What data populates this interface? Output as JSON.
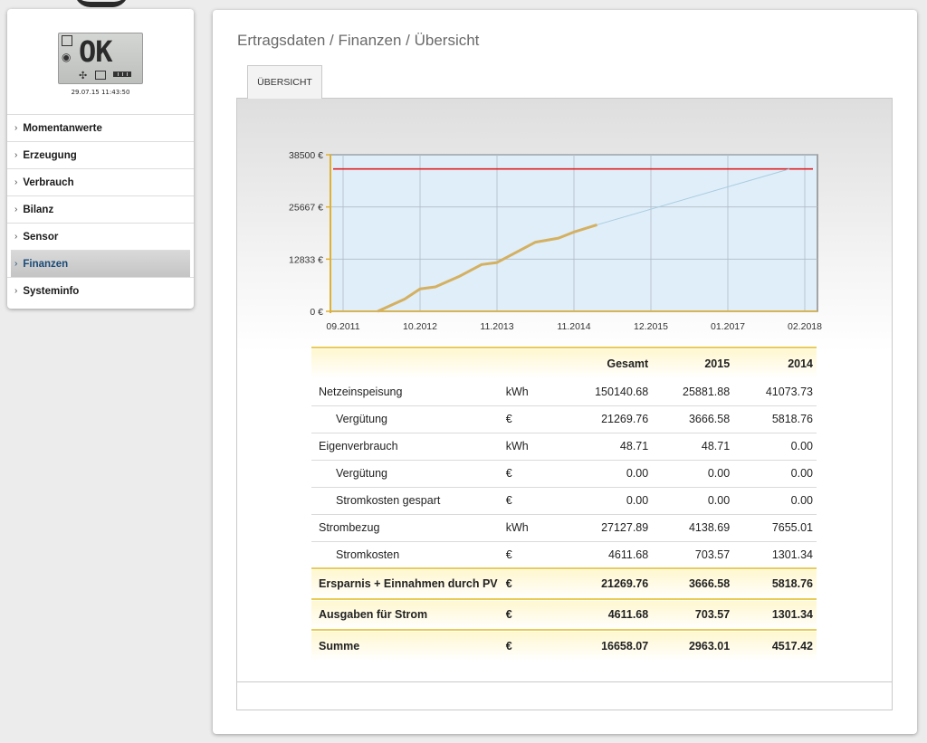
{
  "sidebar": {
    "lcd_text": "OK",
    "datetime": "29.07.15 11:43:50",
    "items": [
      {
        "label": "Momentanwerte",
        "active": false
      },
      {
        "label": "Erzeugung",
        "active": false
      },
      {
        "label": "Verbrauch",
        "active": false
      },
      {
        "label": "Bilanz",
        "active": false
      },
      {
        "label": "Sensor",
        "active": false
      },
      {
        "label": "Finanzen",
        "active": true
      },
      {
        "label": "Systeminfo",
        "active": false
      }
    ]
  },
  "main": {
    "breadcrumb": "Ertragsdaten / Finanzen / Übersicht",
    "tab_label": "ÜBERSICHT"
  },
  "chart_data": {
    "type": "line",
    "y_ticks": [
      "38500 €",
      "25667 €",
      "12833 €",
      "0 €"
    ],
    "y_tick_values": [
      38500,
      25667,
      12833,
      0
    ],
    "x_ticks": [
      "09.2011",
      "10.2012",
      "11.2013",
      "11.2014",
      "12.2015",
      "01.2017",
      "02.2018"
    ],
    "ylim": [
      0,
      38500
    ],
    "grid": true,
    "target_line": 35000,
    "series": [
      {
        "values_x": [
          0.45,
          0.8,
          1.0,
          1.2,
          1.5,
          1.8,
          2.0,
          2.2,
          2.5,
          2.8,
          3.0,
          3.3
        ],
        "values_y": [
          0,
          3000,
          5500,
          6000,
          8500,
          11500,
          12000,
          14000,
          17000,
          18000,
          19500,
          21269
        ],
        "color": "#d4b060"
      },
      {
        "values_x": [
          3.3,
          5.8
        ],
        "values_y": [
          21269,
          35000
        ],
        "color": "#a8cce0"
      }
    ],
    "colors": {
      "plot_bg": "#e0eef9",
      "axis": "#e0b030",
      "target": "#e02020",
      "grid": "#b0bcc8"
    }
  },
  "table": {
    "headers": [
      "",
      "",
      "Gesamt",
      "2015",
      "2014"
    ],
    "rows": [
      {
        "label": "Netzeinspeisung",
        "sub": false,
        "unit": "kWh",
        "values": [
          "150140.68",
          "25881.88",
          "41073.73"
        ]
      },
      {
        "label": "Vergütung",
        "sub": true,
        "unit": "€",
        "values": [
          "21269.76",
          "3666.58",
          "5818.76"
        ]
      },
      {
        "label": "Eigenverbrauch",
        "sub": false,
        "unit": "kWh",
        "values": [
          "48.71",
          "48.71",
          "0.00"
        ]
      },
      {
        "label": "Vergütung",
        "sub": true,
        "unit": "€",
        "values": [
          "0.00",
          "0.00",
          "0.00"
        ]
      },
      {
        "label": "Stromkosten gespart",
        "sub": true,
        "unit": "€",
        "values": [
          "0.00",
          "0.00",
          "0.00"
        ]
      },
      {
        "label": "Strombezug",
        "sub": false,
        "unit": "kWh",
        "values": [
          "27127.89",
          "4138.69",
          "7655.01"
        ]
      },
      {
        "label": "Stromkosten",
        "sub": true,
        "unit": "€",
        "values": [
          "4611.68",
          "703.57",
          "1301.34"
        ]
      }
    ],
    "sums": [
      {
        "label": "Ersparnis + Einnahmen durch PV",
        "unit": "€",
        "values": [
          "21269.76",
          "3666.58",
          "5818.76"
        ]
      },
      {
        "label": "Ausgaben für Strom",
        "unit": "€",
        "values": [
          "4611.68",
          "703.57",
          "1301.34"
        ]
      },
      {
        "label": "Summe",
        "unit": "€",
        "values": [
          "16658.07",
          "2963.01",
          "4517.42"
        ]
      }
    ]
  }
}
